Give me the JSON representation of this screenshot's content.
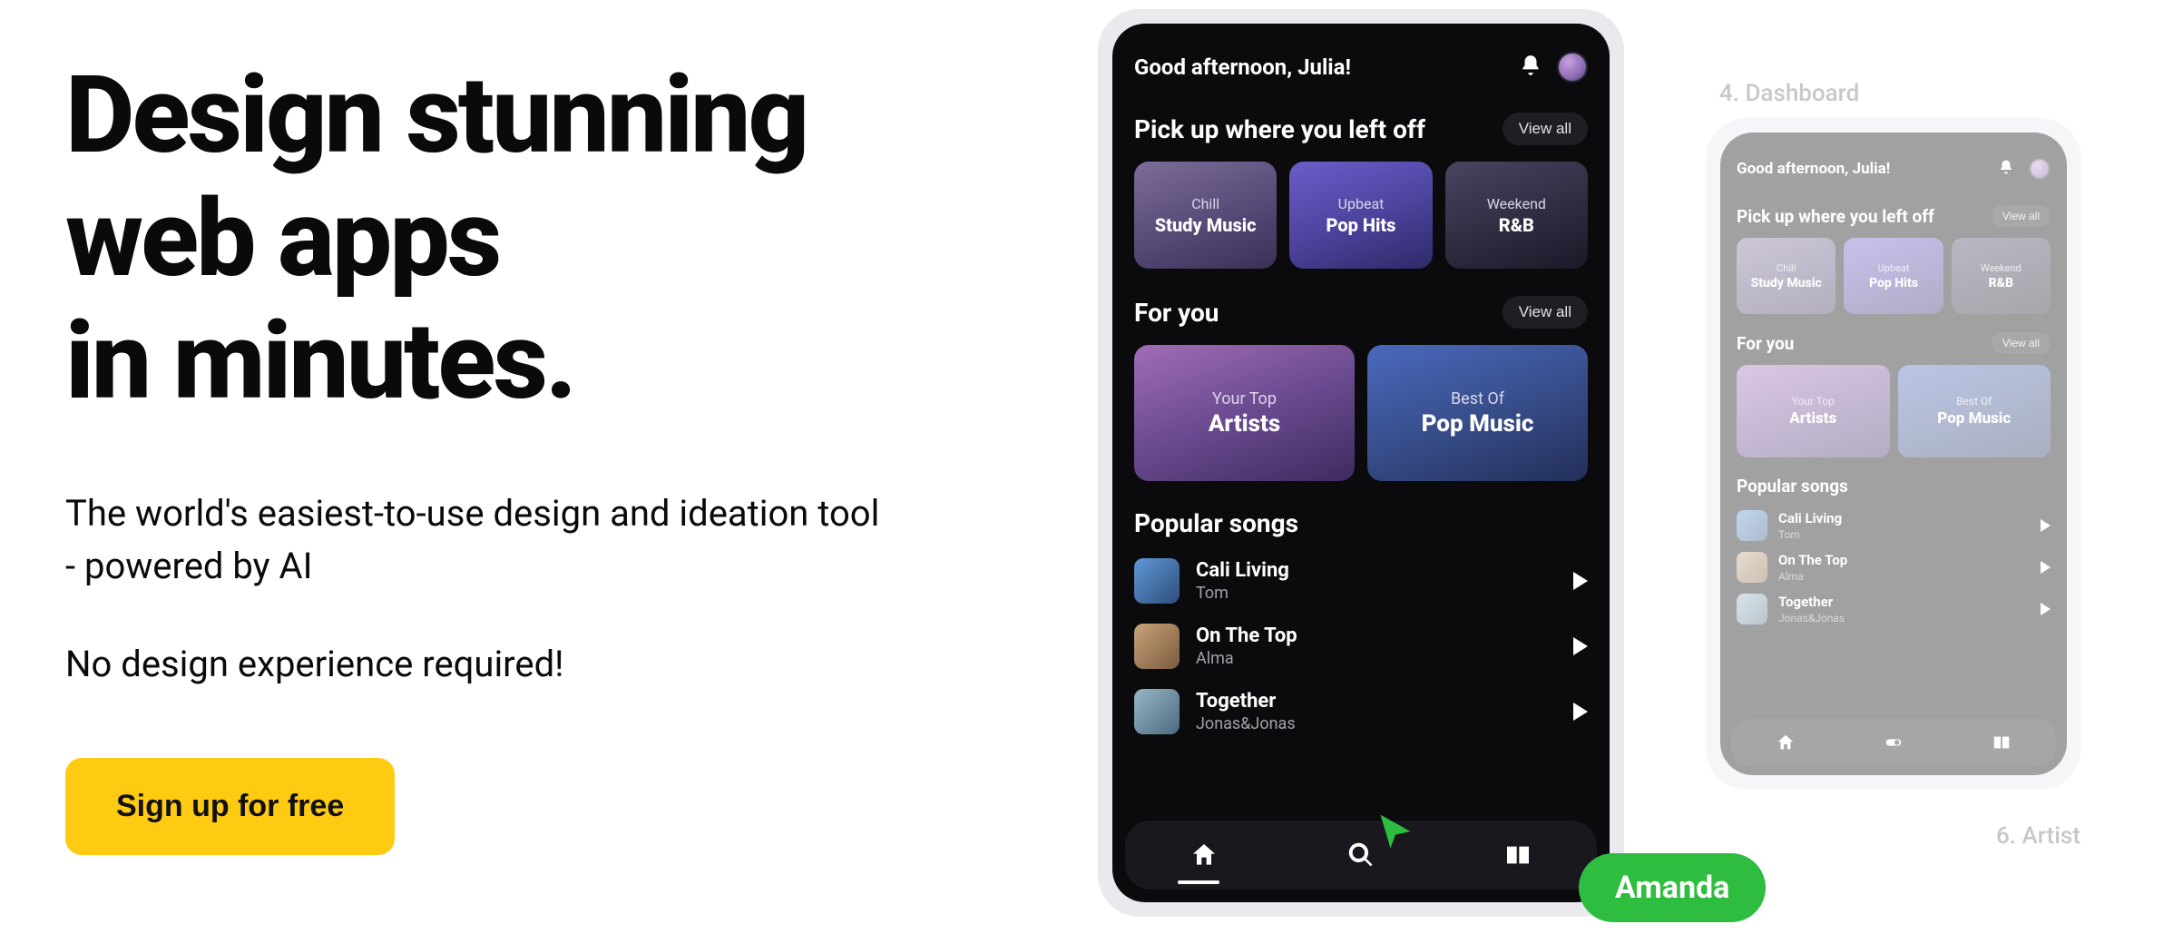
{
  "hero": {
    "headline_l1": "Design stunning",
    "headline_l2": "web apps",
    "headline_l3": "in minutes.",
    "lead": "The world's easiest-to-use design and ideation tool - powered by AI",
    "sub": "No design experience required!",
    "cta": "Sign up for free"
  },
  "collab": {
    "user": "Amanda",
    "color": "#2ebd3e"
  },
  "ghost": {
    "dashboard": "4. Dashboard",
    "artist": "6. Artist"
  },
  "phone": {
    "greeting": "Good afternoon, Julia!",
    "sections": {
      "recent": {
        "title": "Pick up where you left off",
        "viewall": "View all"
      },
      "foryou": {
        "title": "For you",
        "viewall": "View all"
      },
      "popular": {
        "title": "Popular songs"
      }
    },
    "recent_cards": [
      {
        "line1": "Chill",
        "line2": "Study Music"
      },
      {
        "line1": "Upbeat",
        "line2": "Pop Hits"
      },
      {
        "line1": "Weekend",
        "line2": "R&B"
      }
    ],
    "foryou_cards": [
      {
        "line1": "Your Top",
        "line2": "Artists"
      },
      {
        "line1": "Best Of",
        "line2": "Pop Music"
      }
    ],
    "songs": [
      {
        "title": "Cali Living",
        "artist": "Tom"
      },
      {
        "title": "On The Top",
        "artist": "Alma"
      },
      {
        "title": "Together",
        "artist": "Jonas&Jonas"
      }
    ]
  }
}
